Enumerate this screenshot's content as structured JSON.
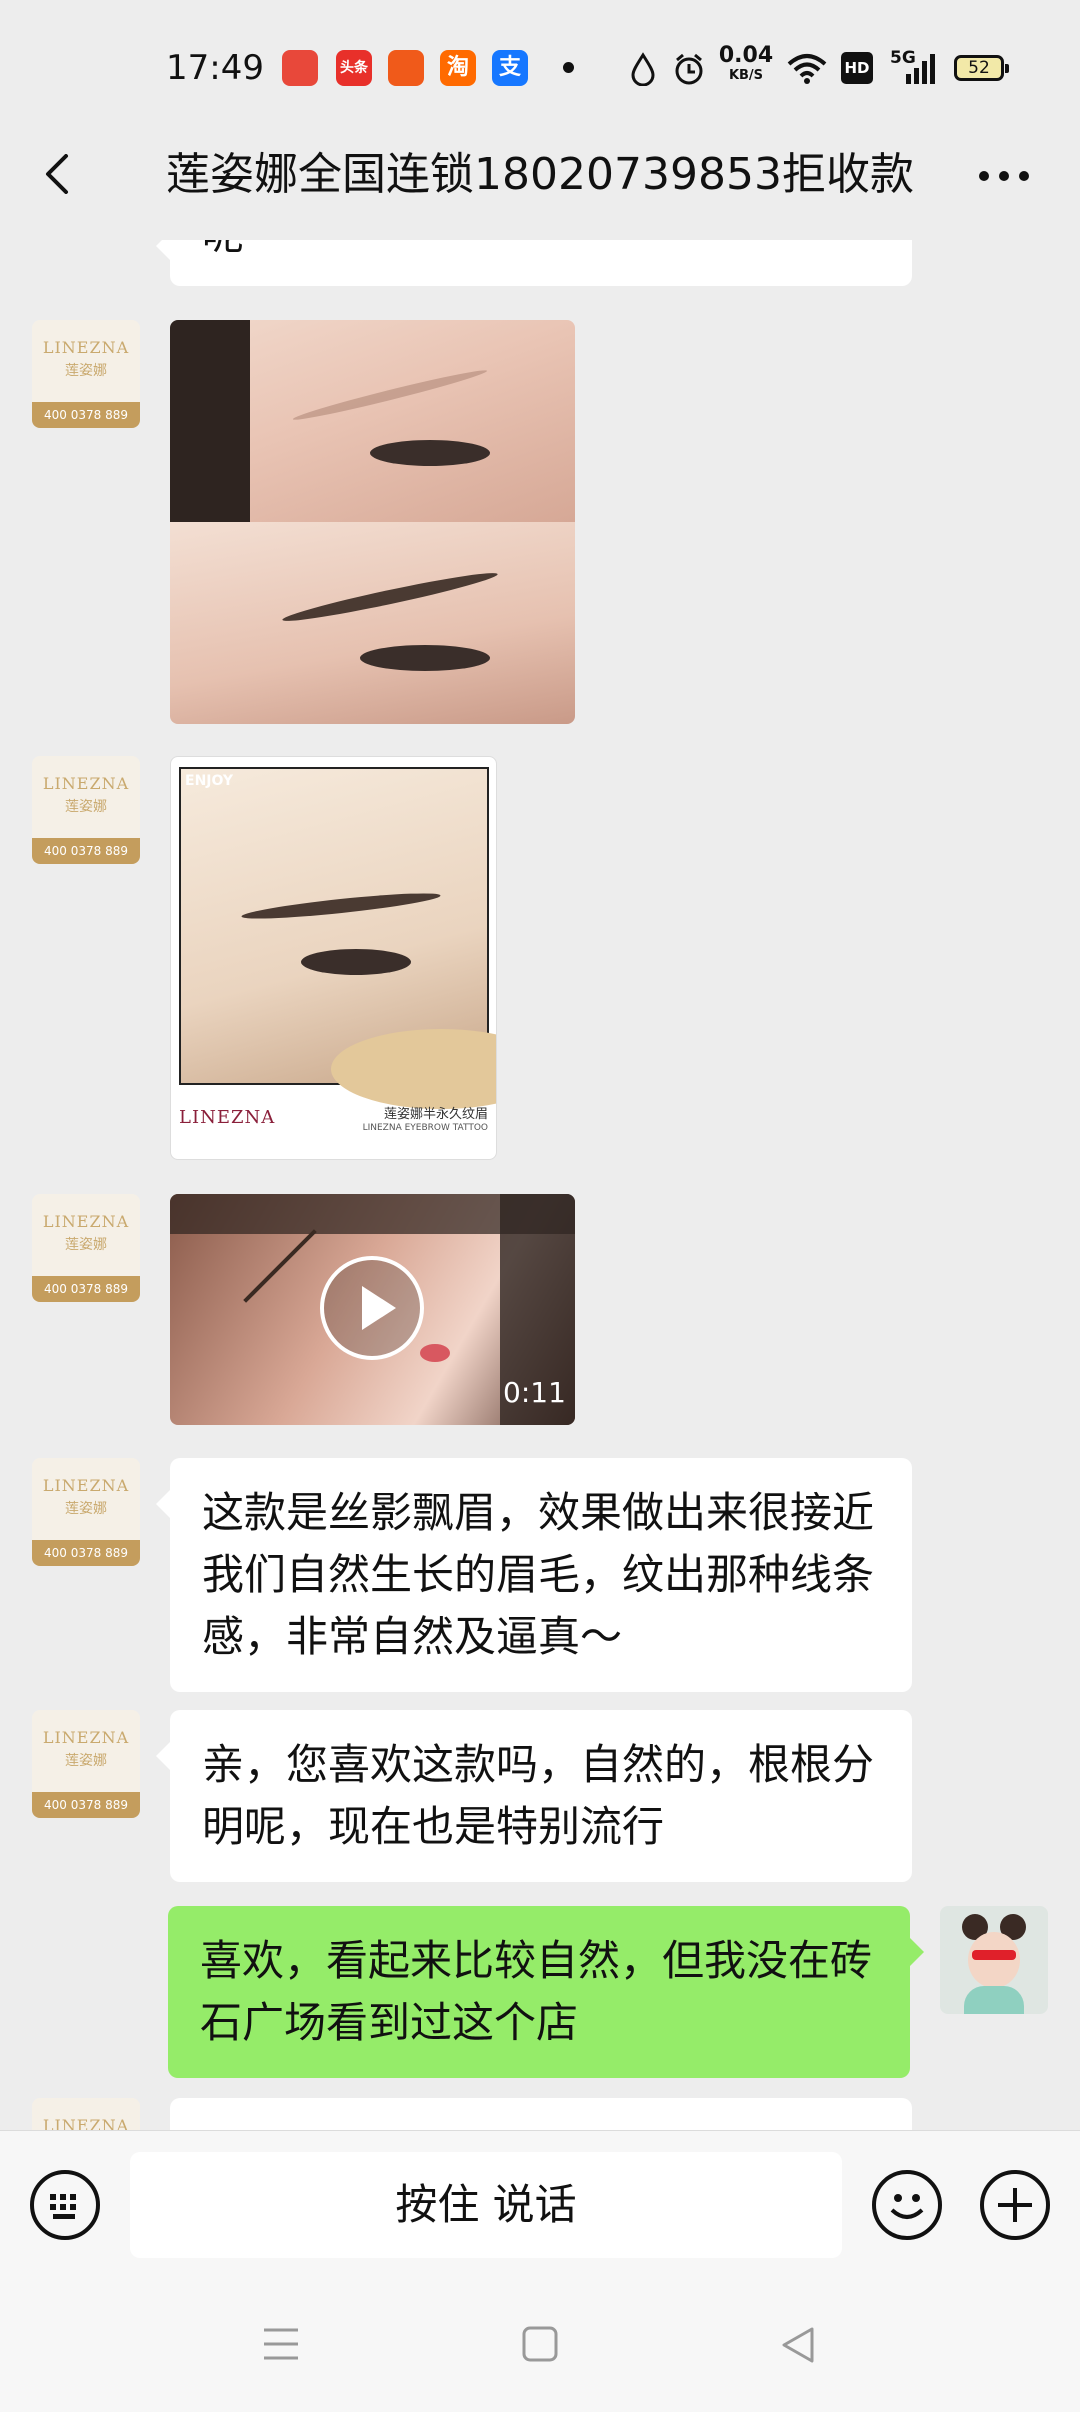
{
  "status_bar": {
    "time": "17:49",
    "apps": [
      {
        "icon": "red-app-icon",
        "label": "",
        "color": "#e8483a"
      },
      {
        "icon": "toutiao-icon",
        "label": "头条",
        "color": "#e8302a"
      },
      {
        "icon": "orange-app-icon",
        "label": "",
        "color": "#f05a1a"
      },
      {
        "icon": "taobao-icon",
        "label": "淘",
        "color": "#ff6a00"
      },
      {
        "icon": "alipay-icon",
        "label": "支",
        "color": "#1677ff"
      }
    ],
    "net_speed_value": "0.04",
    "net_speed_unit": "KB/S",
    "hd": "HD",
    "signal": "5G",
    "battery": "52"
  },
  "header": {
    "title": "莲姿娜全国连锁18020739853拒收款"
  },
  "avatar": {
    "brand": "LINEZNA",
    "brand_cn": "莲姿娜",
    "phone": "400 0378 889"
  },
  "messages": {
    "partial_top": "呢",
    "image_card": {
      "enjoy": "ENJOY",
      "brand": "LINEZNA",
      "caption_cn": "莲姿娜半永久纹眉",
      "caption_en": "LINEZNA EYEBROW TATTOO"
    },
    "video_duration": "0:11",
    "text1": "这款是丝影飘眉，效果做出来很接近我们自然生长的眉毛，纹出那种线条感，非常自然及逼真～",
    "text2": "亲，您喜欢这款吗，自然的，根根分明呢，现在也是特别流行",
    "text3": "喜欢，看起来比较自然，但我没在砖石广场看到过这个店"
  },
  "input_bar": {
    "hold_to_talk": "按住 说话"
  },
  "colors": {
    "chat_bg": "#ededed",
    "self_bubble": "#95ec69",
    "other_bubble": "#ffffff",
    "brand_gold": "#c49d5d"
  }
}
